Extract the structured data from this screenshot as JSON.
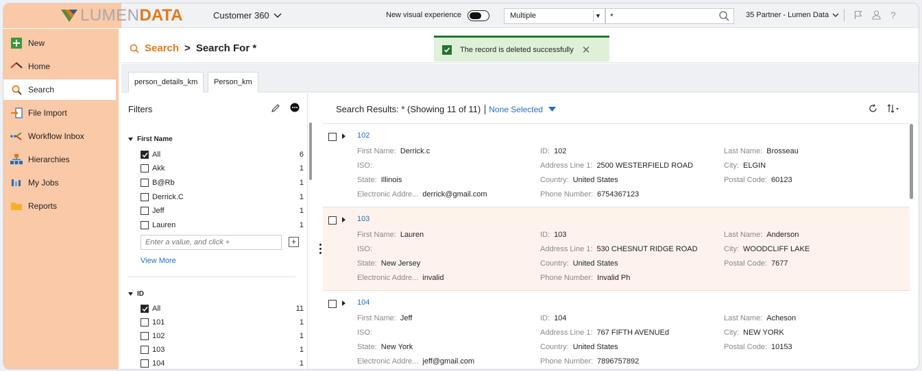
{
  "topbar": {
    "logo_lumen": "LUMEN",
    "logo_data": "DATA",
    "app_title": "Customer 360",
    "new_visual": "New visual experience",
    "entity_select": "Multiple",
    "search_value": "*",
    "partner": "35 Partner - Lumen Data"
  },
  "sidebar": {
    "items": [
      {
        "label": "New"
      },
      {
        "label": "Home"
      },
      {
        "label": "Search"
      },
      {
        "label": "File Import"
      },
      {
        "label": "Workflow Inbox"
      },
      {
        "label": "Hierarchies"
      },
      {
        "label": "My Jobs"
      },
      {
        "label": "Reports"
      }
    ]
  },
  "breadcrumb": {
    "root": "Search",
    "sep": ">",
    "current": "Search For *"
  },
  "toast": {
    "message": "The record is deleted successfully"
  },
  "tabs": [
    {
      "label": "person_details_km"
    },
    {
      "label": "Person_km"
    }
  ],
  "filters": {
    "title": "Filters",
    "first_name": {
      "heading": "First Name",
      "rows": [
        {
          "label": "All",
          "count": "6"
        },
        {
          "label": "Akk",
          "count": "1"
        },
        {
          "label": "B@Rb",
          "count": "1"
        },
        {
          "label": "Derrick.C",
          "count": "1"
        },
        {
          "label": "Jeff",
          "count": "1"
        },
        {
          "label": "Lauren",
          "count": "1"
        }
      ],
      "input_placeholder": "Enter a value, and click +",
      "view_more": "View More"
    },
    "id": {
      "heading": "ID",
      "rows": [
        {
          "label": "All",
          "count": "11"
        },
        {
          "label": "101",
          "count": "1"
        },
        {
          "label": "102",
          "count": "1"
        },
        {
          "label": "103",
          "count": "1"
        },
        {
          "label": "104",
          "count": "1"
        }
      ]
    }
  },
  "results": {
    "heading": "Search Results: * (Showing 11 of 11)",
    "selection": "None Selected",
    "labels": {
      "first_name": "First Name:",
      "iso": "ISO:",
      "state": "State:",
      "electronic": "Electronic Addre...",
      "id": "ID:",
      "address": "Address Line 1:",
      "country": "Country:",
      "phone": "Phone Number:",
      "last_name": "Last Name:",
      "city": "City:",
      "postal": "Postal Code:"
    },
    "records": [
      {
        "rid": "102",
        "first_name": "Derrick.c",
        "iso": "",
        "state": "Illinois",
        "electronic": "derrick@gmail.com",
        "id": "102",
        "address": "2500 WESTERFIELD ROAD",
        "country": "United States",
        "phone": "6754367123",
        "last_name": "Brosseau",
        "city": "ELGIN",
        "postal": "60123"
      },
      {
        "rid": "103",
        "first_name": "Lauren",
        "iso": "",
        "state": "New Jersey",
        "electronic": "invalid",
        "id": "103",
        "address": "530 CHESNUT RIDGE ROAD",
        "country": "United States",
        "phone": "Invalid Ph",
        "last_name": "Anderson",
        "city": "WOODCLIFF LAKE",
        "postal": "7677"
      },
      {
        "rid": "104",
        "first_name": "Jeff",
        "iso": "",
        "state": "New York",
        "electronic": "jeff@gmail.com",
        "id": "104",
        "address": "767 FIFTH AVENUEd",
        "country": "United States",
        "phone": "7896757892",
        "last_name": "Acheson",
        "city": "NEW YORK",
        "postal": "10153"
      }
    ]
  }
}
